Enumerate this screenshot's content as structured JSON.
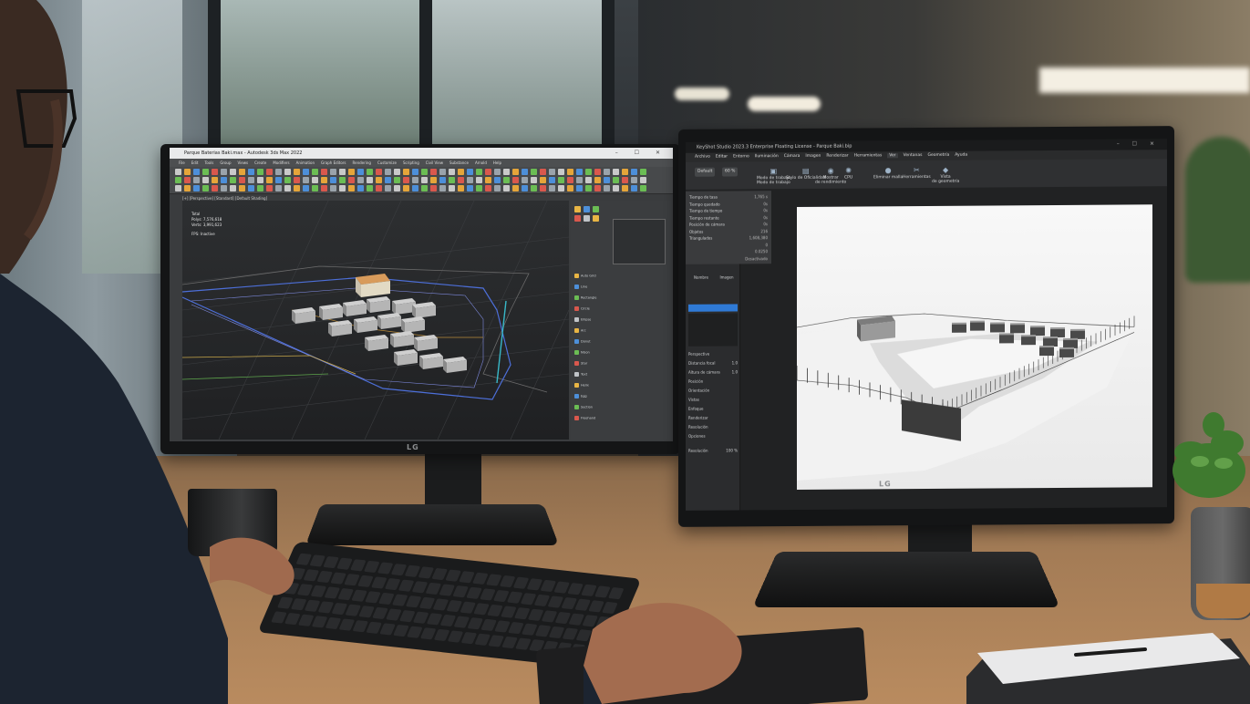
{
  "left_app": {
    "title": "Parque Baterias Baki.max - Autodesk 3ds Max 2022",
    "window_controls": "–  ☐  ✕",
    "menu": [
      "File",
      "Edit",
      "Tools",
      "Group",
      "Views",
      "Create",
      "Modifiers",
      "Animation",
      "Graph Editors",
      "Rendering",
      "Customize",
      "Scripting",
      "Civil View",
      "Substance",
      "Arnold",
      "Help"
    ],
    "viewport_label": "[+] [Perspective] [Standard] [Default Shading]",
    "stats": {
      "label": "Total",
      "polys_label": "Polys:",
      "polys": "7,576,618",
      "verts_label": "Verts:",
      "verts": "3,991,623",
      "fps_label": "FPS:",
      "fps": "Inactive"
    },
    "logo": "LG",
    "panel_items": [
      "Auto Grid",
      "Line",
      "Rectangle",
      "Circle",
      "Ellipse",
      "Arc",
      "Donut",
      "NGon",
      "Star",
      "Text",
      "Helix",
      "Egg",
      "Section",
      "Freehand"
    ]
  },
  "right_app": {
    "title": "KeyShot Studio 2023.3 Enterprise Floating License - Parque Baki.bip",
    "menu": [
      "Archivo",
      "Editar",
      "Entorno",
      "Iluminación",
      "Cámara",
      "Imagen",
      "Renderizar",
      "Herramientas",
      "Ver",
      "Ventanas",
      "Geometría",
      "Ayuda"
    ],
    "active_menu": "Ver",
    "dropdown_1": "Default",
    "dropdown_2": "60 %",
    "toolbar_buttons": [
      {
        "label": "Modo de trabajo",
        "sub": "Modo de trabajo"
      },
      {
        "label": "Stylo de Oficialidad",
        "sub": ""
      },
      {
        "label": "Mostrar",
        "sub": "de rendimiento"
      },
      {
        "label": "CPU",
        "sub": ""
      },
      {
        "label": "Eliminar malla",
        "sub": ""
      },
      {
        "label": "Herramientas",
        "sub": ""
      },
      {
        "label": "Vista",
        "sub": "de geometría"
      }
    ],
    "properties": [
      {
        "k": "Tiempo de tasa",
        "v": "1,765 s"
      },
      {
        "k": "Tiempo quedado",
        "v": "0s"
      },
      {
        "k": "Tiempo de tiempo",
        "v": "0s"
      },
      {
        "k": "Tiempo restante",
        "v": "0s"
      },
      {
        "k": "Posición de cámara",
        "v": "0s"
      },
      {
        "k": "Objetos",
        "v": "216"
      },
      {
        "k": "Triangulados",
        "v": "1,608,380"
      },
      {
        "k": "",
        "v": "0"
      },
      {
        "k": "",
        "v": "0.0250"
      },
      {
        "k": "",
        "v": "Desactivado"
      }
    ],
    "side_tabs": [
      {
        "label": "Nombre"
      },
      {
        "label": "Imagen"
      }
    ],
    "side_rows": [
      "Perspective",
      "Distancia focal",
      "Altura de cámara",
      "Posición",
      "Orientación",
      "Vistas",
      "Enfoque",
      "Renderizar",
      "Resolución",
      "Opciones"
    ],
    "side_values": [
      "",
      "1.0",
      "1.0",
      "",
      "",
      "",
      "",
      "",
      "",
      ""
    ],
    "footer": {
      "label": "Resolución",
      "value": "100 %"
    },
    "logo": "LG"
  },
  "colors": {
    "fence": "#4d6fd9",
    "site_line": "#c8a84a",
    "roof": "#d89b5b",
    "accent": "#2f7ad6"
  }
}
